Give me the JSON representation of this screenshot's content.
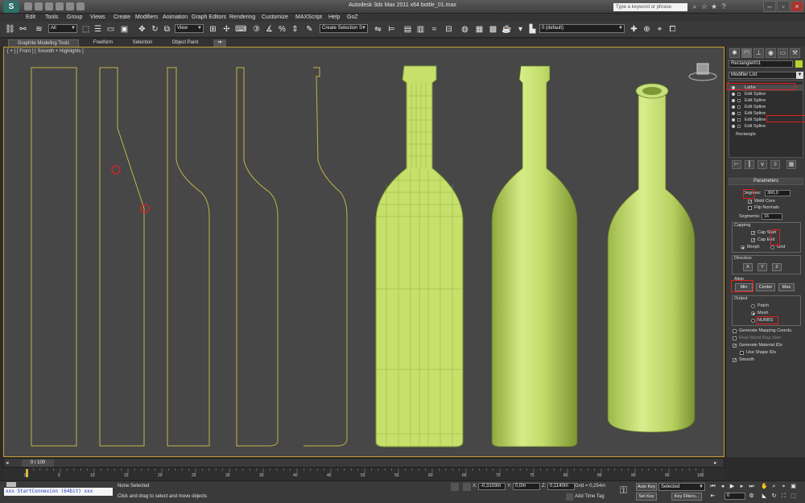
{
  "window": {
    "title": "Autodesk 3ds Max 2011 x64    bottle_01.max",
    "search_placeholder": "Type a keyword or phrase"
  },
  "menu": [
    "Edit",
    "Tools",
    "Group",
    "Views",
    "Create",
    "Modifiers",
    "Animation",
    "Graph Editors",
    "Rendering",
    "Customize",
    "MAXScript",
    "Help",
    "GoZ"
  ],
  "toolbar": {
    "selection_filter": "All",
    "ref_coord": "View",
    "named_selection": "Create Selection S",
    "layer": "0 (default)"
  },
  "ribbon": {
    "tabs": [
      "Graphite Modeling Tools",
      "Freeform",
      "Selection",
      "Object Paint"
    ]
  },
  "viewport": {
    "label": "[ + ] [ Front ] [ Smooth + Highlights ]",
    "accent_color": "#c8a02c",
    "bottle_color": "#c8e07a"
  },
  "command_panel": {
    "object_name": "Rectangle001",
    "object_color": "#b4d62a",
    "modifier_list_label": "Modifier List",
    "stack": [
      "Lathe",
      "Edit Spline",
      "Edit Spline",
      "Edit Spline",
      "Edit Spline",
      "Edit Spline",
      "Edit Spline",
      "Rectangle"
    ],
    "params": {
      "title": "Parameters",
      "degrees_label": "Degrees:",
      "degrees_value": "360,0",
      "weld_core": "Weld Core",
      "flip_normals": "Flip Normals",
      "segments_label": "Segments:",
      "segments_value": "16",
      "capping_title": "Capping",
      "cap_start": "Cap Start",
      "cap_end": "Cap End",
      "morph": "Morph",
      "grid": "Grid",
      "direction_title": "Direction",
      "dir_x": "X",
      "dir_y": "Y",
      "dir_z": "Z",
      "align_title": "Align",
      "align_min": "Min",
      "align_center": "Center",
      "align_max": "Max",
      "output_title": "Output",
      "out_patch": "Patch",
      "out_mesh": "Mesh",
      "out_nurbs": "NURBS",
      "gen_mapping": "Generate Mapping Coords.",
      "real_world": "Real-World Map Size",
      "gen_material": "Generate Material IDs",
      "use_shape": "Use Shape IDs",
      "smooth": "Smooth"
    }
  },
  "timeline": {
    "frame_counter": "0 / 100",
    "ticks": [
      "0",
      "5",
      "10",
      "15",
      "20",
      "25",
      "30",
      "35",
      "40",
      "45",
      "50",
      "55",
      "60",
      "65",
      "70",
      "75",
      "80",
      "85",
      "90",
      "95",
      "100"
    ]
  },
  "status": {
    "maxscript": "xxx StartConnexion (64bit) xxx",
    "selection": "None Selected",
    "prompt": "Click and drag to select and move objects",
    "x_label": "X:",
    "x_value": "-0,3103m",
    "y_label": "Y:",
    "y_value": "0,0m",
    "z_label": "Z:",
    "z_value": "0,1140m",
    "grid": "Grid = 0,254m",
    "add_time_tag": "Add Time Tag",
    "auto_key": "Auto Key",
    "set_key": "Set Key",
    "key_mode": "Selected",
    "key_filters": "Key Filters...",
    "frame_value": "0"
  }
}
